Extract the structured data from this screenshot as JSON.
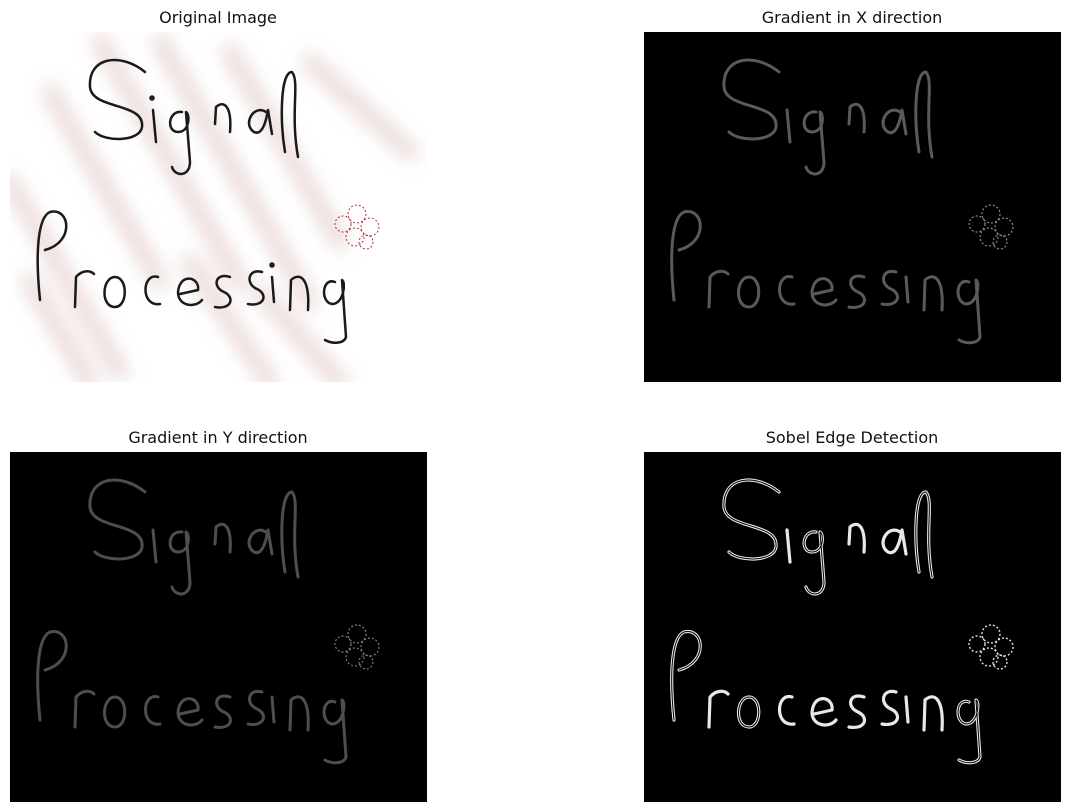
{
  "panels": [
    {
      "title": "Original Image",
      "content_text": "Signal Processing"
    },
    {
      "title": "Gradient in X direction",
      "content_text": "Signal Processing"
    },
    {
      "title": "Gradient in Y direction",
      "content_text": "Signal Processing"
    },
    {
      "title": "Sobel Edge Detection",
      "content_text": "Signal Processing"
    }
  ],
  "colors": {
    "page_bg": "#ffffff",
    "dark_bg": "#000000",
    "ink": "#1a1a1a",
    "stripe_pink": "#e9d4d4",
    "flower_red": "#b0353a"
  }
}
